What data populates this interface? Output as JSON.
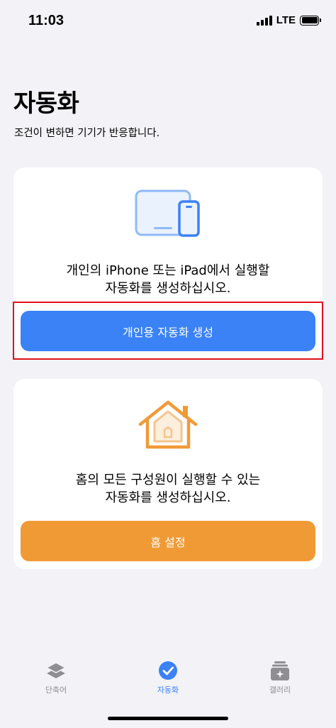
{
  "status": {
    "time": "11:03",
    "network": "LTE"
  },
  "header": {
    "title": "자동화",
    "subtitle": "조건이 변하면 기기가 반응합니다."
  },
  "personal_card": {
    "line1": "개인의 iPhone 또는 iPad에서 실행할",
    "line2": "자동화를 생성하십시오.",
    "button_label": "개인용 자동화 생성",
    "icon": "devices-icon",
    "accent": "#3a82f6"
  },
  "home_card": {
    "line1": "홈의 모든 구성원이 실행할 수 있는",
    "line2": "자동화를 생성하십시오.",
    "button_label": "홈 설정",
    "icon": "home-icon",
    "accent": "#f09a36"
  },
  "tabs": [
    {
      "label": "단축어",
      "icon": "layers-icon",
      "active": false
    },
    {
      "label": "자동화",
      "icon": "checkmark-clock-icon",
      "active": true
    },
    {
      "label": "갤러리",
      "icon": "gallery-icon",
      "active": false
    }
  ]
}
